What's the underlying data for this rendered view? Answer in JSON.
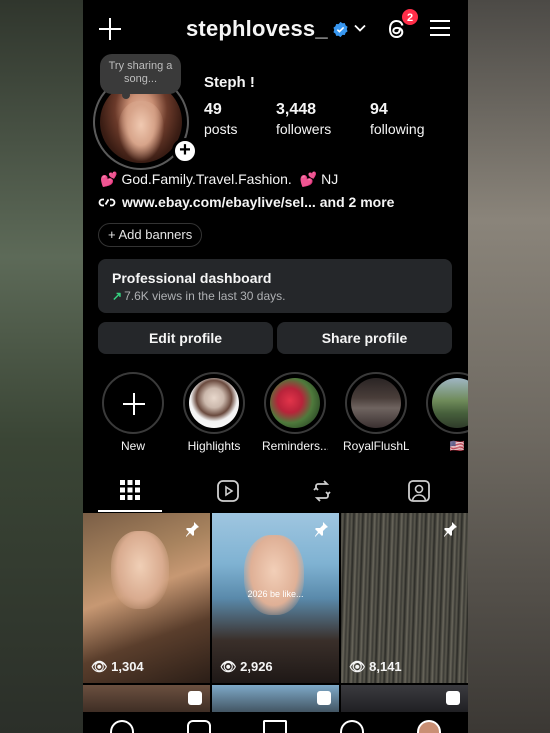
{
  "header": {
    "username": "stephlovess_",
    "notification_count": "2"
  },
  "profile": {
    "song_prompt": "Try sharing a song...",
    "display_name": "Steph !",
    "stats": [
      {
        "value": "49",
        "label": "posts"
      },
      {
        "value": "3,448",
        "label": "followers"
      },
      {
        "value": "94",
        "label": "following"
      }
    ],
    "bio": "God.Family.Travel.Fashion.",
    "bio_suffix": "NJ",
    "link": "www.ebay.com/ebaylive/sel...",
    "link_more": "and 2 more",
    "add_banners": "+ Add banners"
  },
  "dashboard": {
    "title": "Professional dashboard",
    "subtitle": "7.6K views in the last 30 days."
  },
  "buttons": {
    "edit": "Edit profile",
    "share": "Share profile"
  },
  "highlights": [
    {
      "label": "New"
    },
    {
      "label": "Highlights"
    },
    {
      "label": "Reminders..."
    },
    {
      "label": "RoyalFlushL..."
    },
    {
      "label": "🇺🇸"
    }
  ],
  "posts": [
    {
      "views": "1,304"
    },
    {
      "views": "2,926",
      "caption": "2026 be like..."
    },
    {
      "views": "8,141"
    }
  ],
  "colors": {
    "verified": "#3897f0",
    "badge": "#ff2d48",
    "trend": "#35d07f"
  }
}
